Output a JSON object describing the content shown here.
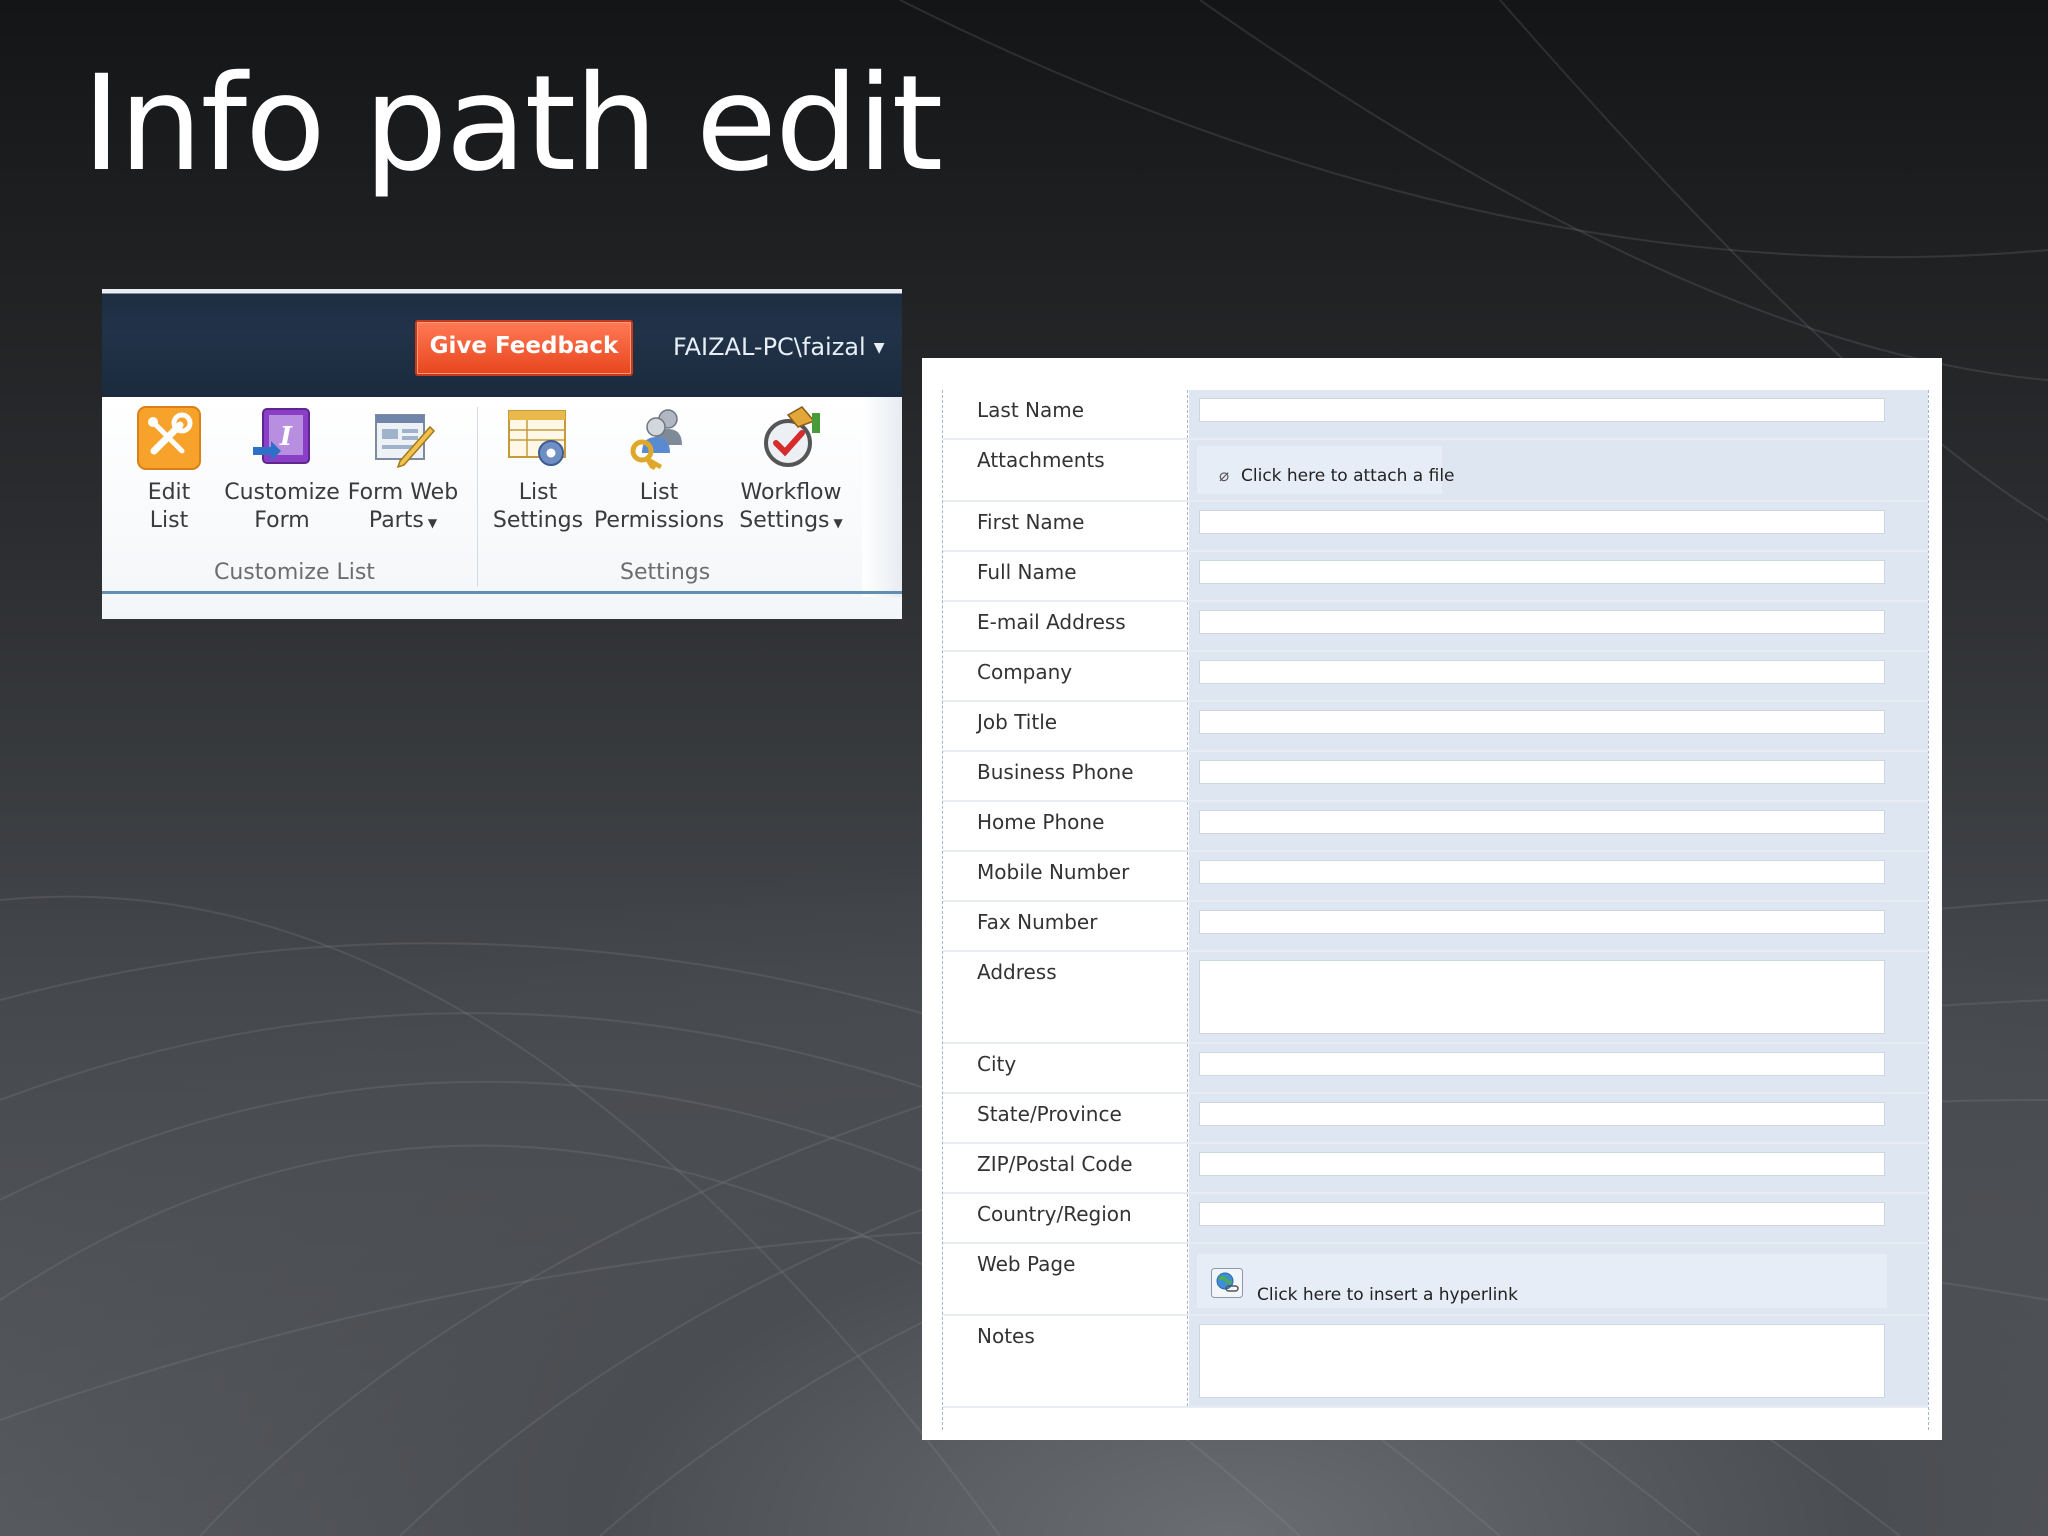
{
  "slide": {
    "title": "Info path edit"
  },
  "ribbon": {
    "feedback_label": "Give Feedback",
    "user_label": "FAIZAL-PC\\faizal",
    "buttons": {
      "edit_list": [
        "Edit",
        "List"
      ],
      "customize_form": [
        "Customize",
        "Form"
      ],
      "form_web_parts": [
        "Form Web",
        "Parts"
      ],
      "list_settings": [
        "List",
        "Settings"
      ],
      "list_permissions": [
        "List",
        "Permissions"
      ],
      "workflow_settings": [
        "Workflow",
        "Settings"
      ]
    },
    "groups": {
      "customize_list": "Customize List",
      "settings": "Settings"
    },
    "colors": {
      "feedback": "#e8461e",
      "topbar": "#1d2d42"
    }
  },
  "form": {
    "fields": {
      "last_name": "Last Name",
      "attachments": "Attachments",
      "attach_action": "Click here to attach a file",
      "first_name": "First Name",
      "full_name": "Full Name",
      "email": "E-mail Address",
      "company": "Company",
      "job_title": "Job Title",
      "business_phone": "Business Phone",
      "home_phone": "Home Phone",
      "mobile_number": "Mobile Number",
      "fax_number": "Fax Number",
      "address": "Address",
      "city": "City",
      "state": "State/Province",
      "zip": "ZIP/Postal Code",
      "country": "Country/Region",
      "web_page": "Web Page",
      "hyperlink_action": "Click here to insert a hyperlink",
      "notes": "Notes"
    },
    "colors": {
      "value_column": "#dde6f1"
    }
  }
}
